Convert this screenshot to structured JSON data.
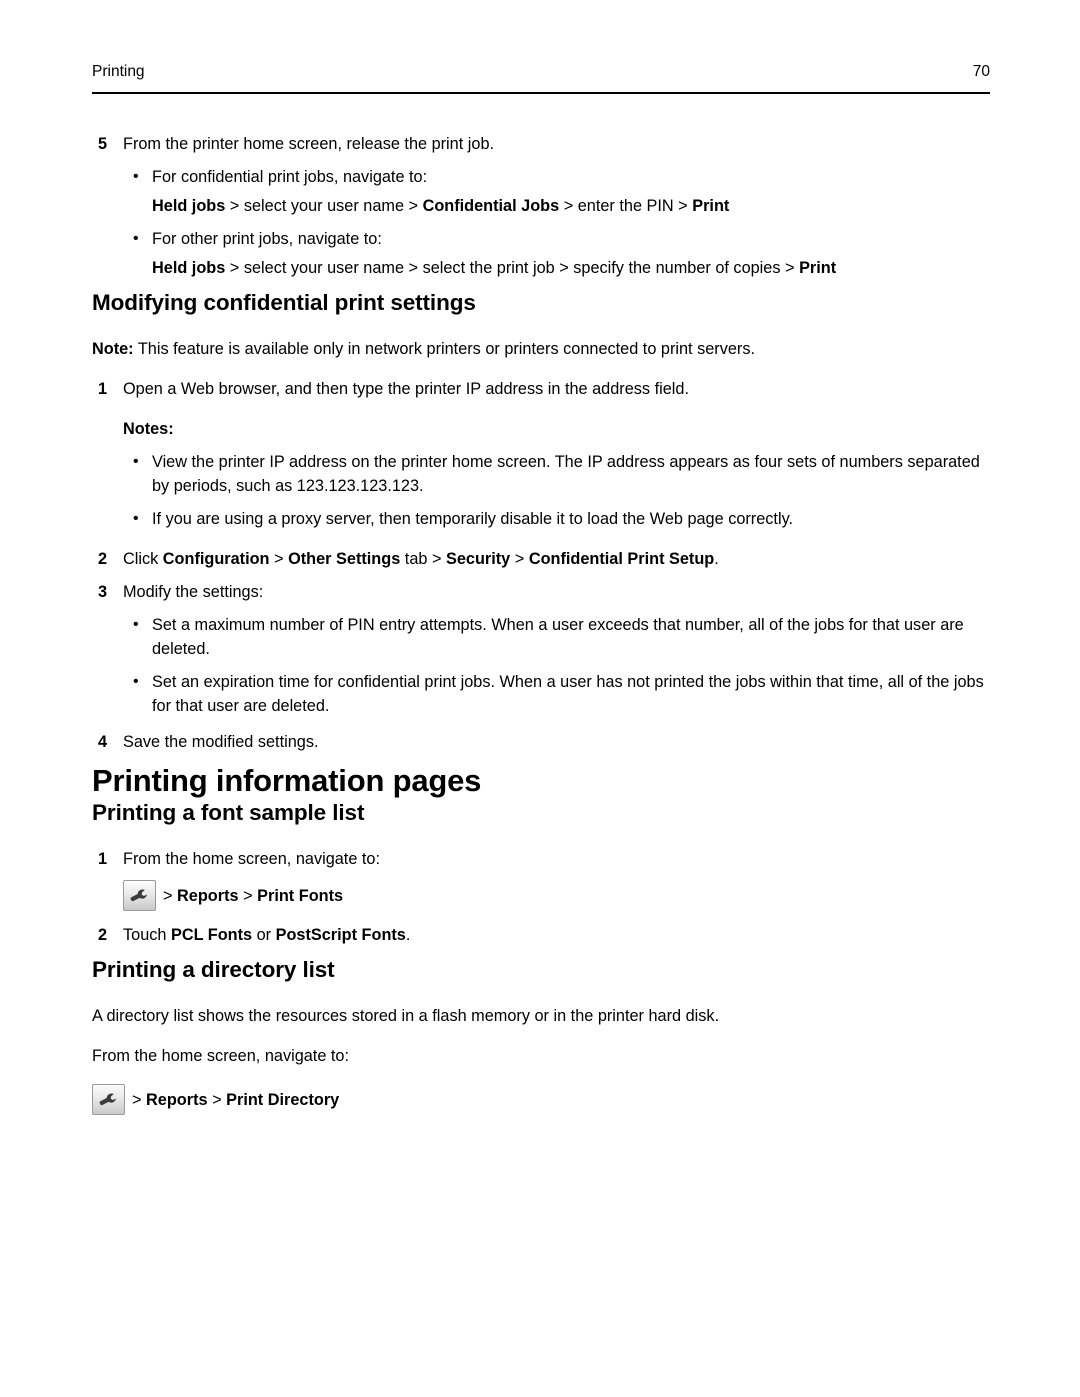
{
  "header": {
    "section_title": "Printing",
    "page_number": "70"
  },
  "steps_release": {
    "step5": {
      "num": "5",
      "text": "From the printer home screen, release the print job.",
      "bullets": [
        {
          "text": "For confidential print jobs, navigate to:",
          "path_parts": [
            {
              "text": "Held jobs",
              "bold": true
            },
            {
              "text": " > select your user name > ",
              "bold": false
            },
            {
              "text": "Confidential Jobs",
              "bold": true
            },
            {
              "text": " > enter the PIN > ",
              "bold": false
            },
            {
              "text": "Print",
              "bold": true
            }
          ]
        },
        {
          "text": "For other print jobs, navigate to:",
          "path_parts": [
            {
              "text": "Held jobs",
              "bold": true
            },
            {
              "text": " > select your user name > select the print job > specify the number of copies > ",
              "bold": false
            },
            {
              "text": "Print",
              "bold": true
            }
          ]
        }
      ]
    }
  },
  "section_modifying": {
    "heading": "Modifying confidential print settings",
    "note_label": "Note:",
    "note_text": " This feature is available only in network printers or printers connected to print servers.",
    "step1": {
      "num": "1",
      "text": "Open a Web browser, and then type the printer IP address in the address field."
    },
    "notes_label": "Notes:",
    "notes": [
      "View the printer IP address on the printer home screen. The IP address appears as four sets of numbers separated by periods, such as 123.123.123.123.",
      "If you are using a proxy server, then temporarily disable it to load the Web page correctly."
    ],
    "step2": {
      "num": "2",
      "parts": [
        {
          "text": "Click ",
          "bold": false
        },
        {
          "text": "Configuration",
          "bold": true
        },
        {
          "text": " > ",
          "bold": false
        },
        {
          "text": "Other Settings",
          "bold": true
        },
        {
          "text": " tab > ",
          "bold": false
        },
        {
          "text": "Security",
          "bold": true
        },
        {
          "text": " > ",
          "bold": false
        },
        {
          "text": "Confidential Print Setup",
          "bold": true
        },
        {
          "text": ".",
          "bold": false
        }
      ]
    },
    "step3": {
      "num": "3",
      "text": "Modify the settings:",
      "bullets": [
        "Set a maximum number of PIN entry attempts. When a user exceeds that number, all of the jobs for that user are deleted.",
        "Set an expiration time for confidential print jobs. When a user has not printed the jobs within that time, all of the jobs for that user are deleted."
      ]
    },
    "step4": {
      "num": "4",
      "text": "Save the modified settings."
    }
  },
  "section_info_pages": {
    "heading": "Printing information pages",
    "font_sample": {
      "heading": "Printing a font sample list",
      "step1": {
        "num": "1",
        "text": "From the home screen, navigate to:"
      },
      "nav_icon": "wrench-settings-icon",
      "nav_path_parts": [
        {
          "text": "> ",
          "bold": false
        },
        {
          "text": "Reports",
          "bold": true
        },
        {
          "text": " > ",
          "bold": false
        },
        {
          "text": "Print Fonts",
          "bold": true
        }
      ],
      "step2": {
        "num": "2",
        "parts": [
          {
            "text": "Touch ",
            "bold": false
          },
          {
            "text": "PCL Fonts",
            "bold": true
          },
          {
            "text": " or ",
            "bold": false
          },
          {
            "text": "PostScript Fonts",
            "bold": true
          },
          {
            "text": ".",
            "bold": false
          }
        ]
      }
    },
    "directory": {
      "heading": "Printing a directory list",
      "paragraph1": "A directory list shows the resources stored in a flash memory or in the printer hard disk.",
      "paragraph2": "From the home screen, navigate to:",
      "nav_icon": "wrench-settings-icon",
      "nav_path_parts": [
        {
          "text": "> ",
          "bold": false
        },
        {
          "text": "Reports",
          "bold": true
        },
        {
          "text": " > ",
          "bold": false
        },
        {
          "text": "Print Directory",
          "bold": true
        }
      ]
    }
  },
  "glyphs": {
    "bullet_dot": "•"
  }
}
